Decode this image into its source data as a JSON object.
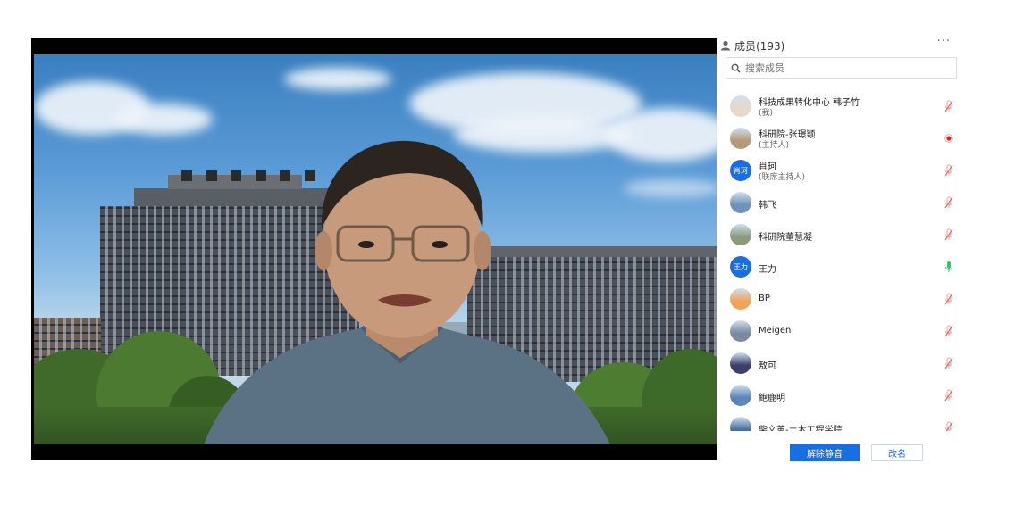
{
  "members_panel": {
    "title": "成员(193)",
    "more_label": "···",
    "search_placeholder": "搜索成员",
    "members": [
      {
        "name": "科技成果转化中心  韩子竹",
        "role": "(我)",
        "avatar_text": "",
        "avatar_color": "#e8d8c8",
        "mic": "muted"
      },
      {
        "name": "科研院-张璟颖",
        "role": "(主持人)",
        "avatar_text": "",
        "avatar_color": "#b59a7a",
        "mic": "recording"
      },
      {
        "name": "肖珂",
        "role": "(联席主持人)",
        "avatar_text": "肖珂",
        "avatar_color": "#1a6fe0",
        "mic": "muted"
      },
      {
        "name": "韩飞",
        "role": "",
        "avatar_text": "",
        "avatar_color": "#6f93b6",
        "mic": "muted"
      },
      {
        "name": "科研院董慧凝",
        "role": "",
        "avatar_text": "",
        "avatar_color": "#8a9a7a",
        "mic": "muted"
      },
      {
        "name": "王力",
        "role": "",
        "avatar_text": "王力",
        "avatar_color": "#1a6fe0",
        "mic": "active"
      },
      {
        "name": "BP",
        "role": "",
        "avatar_text": "",
        "avatar_color": "#f2a35a",
        "mic": "muted"
      },
      {
        "name": "Meigen",
        "role": "",
        "avatar_text": "",
        "avatar_color": "#7a8aa0",
        "mic": "muted"
      },
      {
        "name": "敖可",
        "role": "",
        "avatar_text": "",
        "avatar_color": "#3b3f6a",
        "mic": "muted"
      },
      {
        "name": "鲍鹿明",
        "role": "",
        "avatar_text": "",
        "avatar_color": "#5d86b8",
        "mic": "muted"
      },
      {
        "name": "柴文革-土木工程学院",
        "role": "",
        "avatar_text": "",
        "avatar_color": "#4a6f9a",
        "mic": "muted"
      }
    ],
    "unmute_all_label": "解除静音",
    "rename_label": "改名"
  },
  "colors": {
    "accent": "#1a6fe0",
    "mic_muted": "#e06a6a",
    "mic_active": "#3cc46b",
    "recording": "#e02020"
  },
  "icons": {
    "people": "people-icon",
    "search": "search-icon",
    "mic_muted": "mic-muted-icon",
    "mic_active": "mic-active-icon",
    "recording": "recording-dot-icon"
  }
}
